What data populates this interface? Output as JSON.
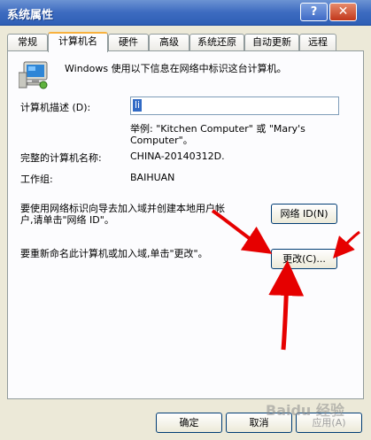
{
  "window": {
    "title": "系统属性",
    "help_glyph": "?",
    "close_glyph": "✕"
  },
  "tabs": [
    {
      "label": "常规"
    },
    {
      "label": "计算机名"
    },
    {
      "label": "硬件"
    },
    {
      "label": "高级"
    },
    {
      "label": "系统还原"
    },
    {
      "label": "自动更新"
    },
    {
      "label": "远程"
    }
  ],
  "main": {
    "intro": "Windows 使用以下信息在网络中标识这台计算机。",
    "description_label": "计算机描述 (D):",
    "description_value": "li",
    "example_line1": "举例: \"Kitchen Computer\" 或 \"Mary's",
    "example_line2": "Computer\"。",
    "fullname_label": "完整的计算机名称:",
    "fullname_value": "CHINA-20140312D.",
    "workgroup_label": "工作组:",
    "workgroup_value": "BAIHUAN",
    "network_id_text_line1": "要使用网络标识向导去加入域并创建本地用户帐",
    "network_id_text_line2": "户,请单击\"网络 ID\"。",
    "network_id_button": "网络 ID(N)",
    "rename_text": "要重新命名此计算机或加入域,单击\"更改\"。",
    "change_button": "更改(C)..."
  },
  "footer": {
    "ok_button": "确定",
    "cancel_button": "取消",
    "apply_button": "应用(A)"
  },
  "watermark": "Baidu 经验",
  "colors": {
    "annotation_arrow": "#e60000",
    "title_bar": "#3d6bc0"
  }
}
